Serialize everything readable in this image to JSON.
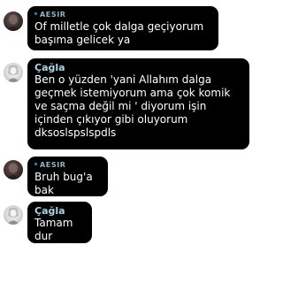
{
  "messages": [
    {
      "author": "AESIR",
      "text": "Of milletle çok dalga geçiyorum\nbaşıma gelicek ya"
    },
    {
      "author": "Çağla",
      "text": "Ben o yüzden 'yani Allahım dalga\ngeçmek istemiyorum ama çok komik\nve saçma değil mi ' diyorum işin\niçinden çıkıyor gibi oluyorum\ndksoslspslspdls"
    },
    {
      "author": "AESIR",
      "text": "Bruh bug'a bak"
    },
    {
      "author": "Çağla",
      "text": "Tamam dur"
    }
  ],
  "colors": {
    "bubble": "#000000",
    "aesir_name": "#8fb7c9",
    "cagla_name": "#a9d4e8",
    "aesir_dot": "#2e8bcf"
  },
  "icons": {
    "aesir_avatar": "profile-photo-dark",
    "cagla_avatar": "profile-photo-light"
  }
}
